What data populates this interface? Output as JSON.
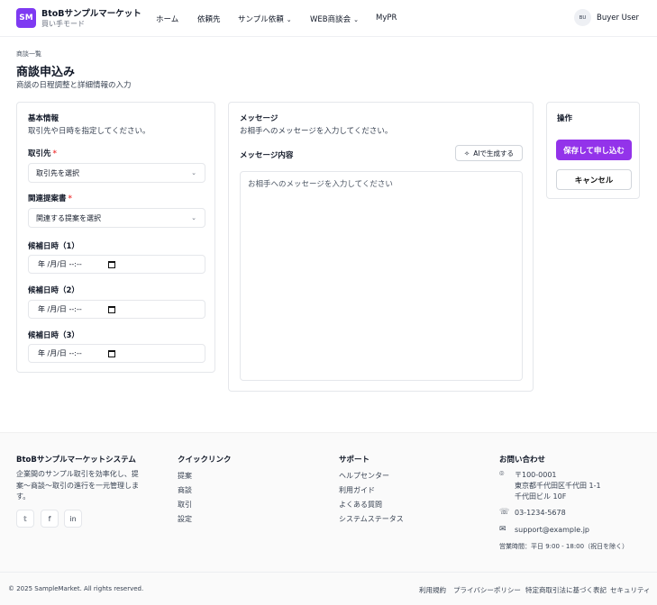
{
  "header": {
    "logo": "SM",
    "brand_name": "BtoBサンプルマーケット",
    "brand_mode": "買い手モード",
    "nav": [
      {
        "label": "ホーム"
      },
      {
        "label": "依頼先"
      },
      {
        "label": "サンプル依頼"
      },
      {
        "label": "WEB商談会"
      },
      {
        "label": "MyPR"
      }
    ],
    "user_initials": "BU",
    "user_name": "Buyer User"
  },
  "page": {
    "breadcrumb": "商談一覧",
    "title": "商談申込み",
    "subtitle": "商談の日程調整と詳細情報の入力"
  },
  "basic_info": {
    "title": "基本情報",
    "description": "取引先や日時を指定してください。",
    "partner_label": "取引先",
    "partner_required": "*",
    "partner_value": "取引先を選択",
    "proposal_label": "関連提案書",
    "proposal_required": "*",
    "proposal_value": "関連する提案を選択",
    "date1_label": "候補日時（1）",
    "date2_label": "候補日時（2）",
    "date3_label": "候補日時（3）",
    "date_placeholder": "年 /月/日 --:--"
  },
  "message": {
    "title": "メッセージ",
    "description": "お相手へのメッセージを入力してください。",
    "content_label": "メッセージ内容",
    "ai_button": "AIで生成する",
    "placeholder": "お相手へのメッセージを入力してください"
  },
  "actions": {
    "title": "操作",
    "submit": "保存して申し込む",
    "cancel": "キャンセル"
  },
  "footer": {
    "company_title": "BtoBサンプルマーケットシステム",
    "company_desc": "企業間のサンプル取引を効率化し、提案〜商談〜取引の進行を一元管理します。",
    "quick_title": "クイックリンク",
    "quick_links": [
      "提案",
      "商談",
      "取引",
      "設定"
    ],
    "support_title": "サポート",
    "support_links": [
      "ヘルプセンター",
      "利用ガイド",
      "よくある質問",
      "システムステータス"
    ],
    "contact_title": "お問い合わせ",
    "postal": "〒100-0001",
    "address1": "東京都千代田区千代田 1-1",
    "address2": "千代田ビル 10F",
    "phone": "03-1234-5678",
    "email": "support@example.jp",
    "hours": "営業時間：平日 9:00 - 18:00（祝日を除く）",
    "copyright": "© 2025 SampleMarket. All rights reserved.",
    "bottom_links": [
      "利用規約",
      "プライバシーポリシー",
      "特定商取引法に基づく表記",
      "セキュリティ"
    ]
  },
  "colors": {
    "accent": "#9333ea",
    "logo_bg": "#7e3af2",
    "required": "#ef4444"
  }
}
